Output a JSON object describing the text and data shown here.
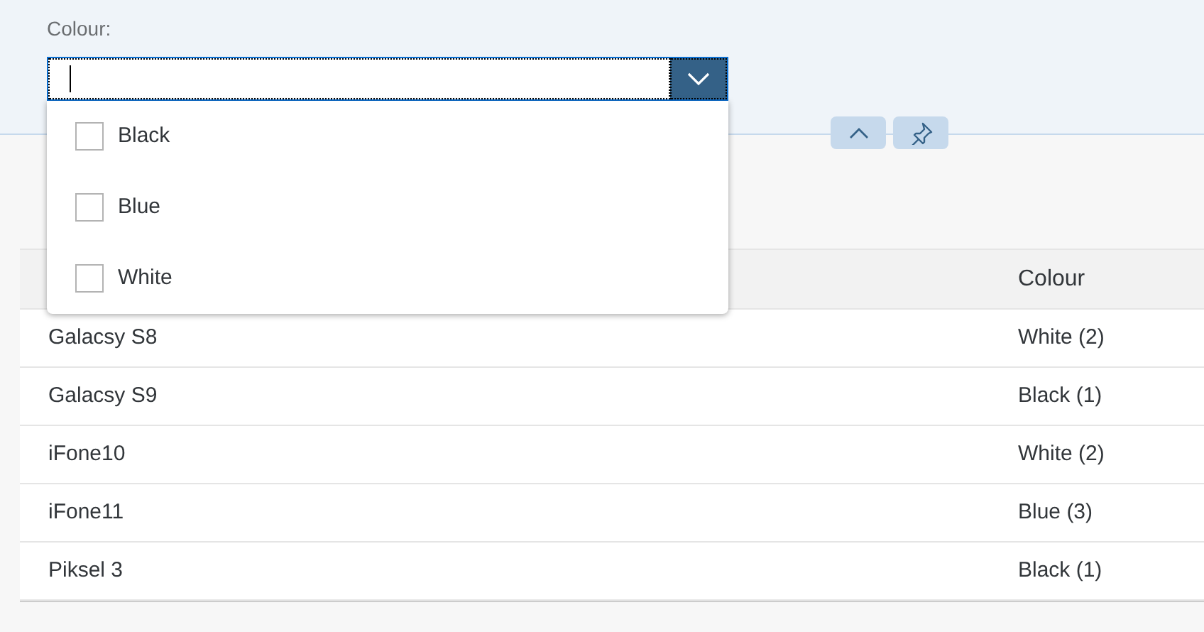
{
  "filter": {
    "label": "Colour:",
    "open": true,
    "options": [
      {
        "label": "Black",
        "checked": false
      },
      {
        "label": "Blue",
        "checked": false
      },
      {
        "label": "White",
        "checked": false
      }
    ]
  },
  "table": {
    "columns": [
      {
        "label": "Colour"
      }
    ],
    "rows": [
      {
        "column_1": "Galacsy S8",
        "colour": "White (2)"
      },
      {
        "column_1": "Galacsy S9",
        "colour": "Black (1)"
      },
      {
        "column_1": "iFone10",
        "colour": "White (2)"
      },
      {
        "column_1": "iFone11",
        "colour": "Blue (3)"
      },
      {
        "column_1": "Piksel 3",
        "colour": "Black (1)"
      }
    ]
  }
}
